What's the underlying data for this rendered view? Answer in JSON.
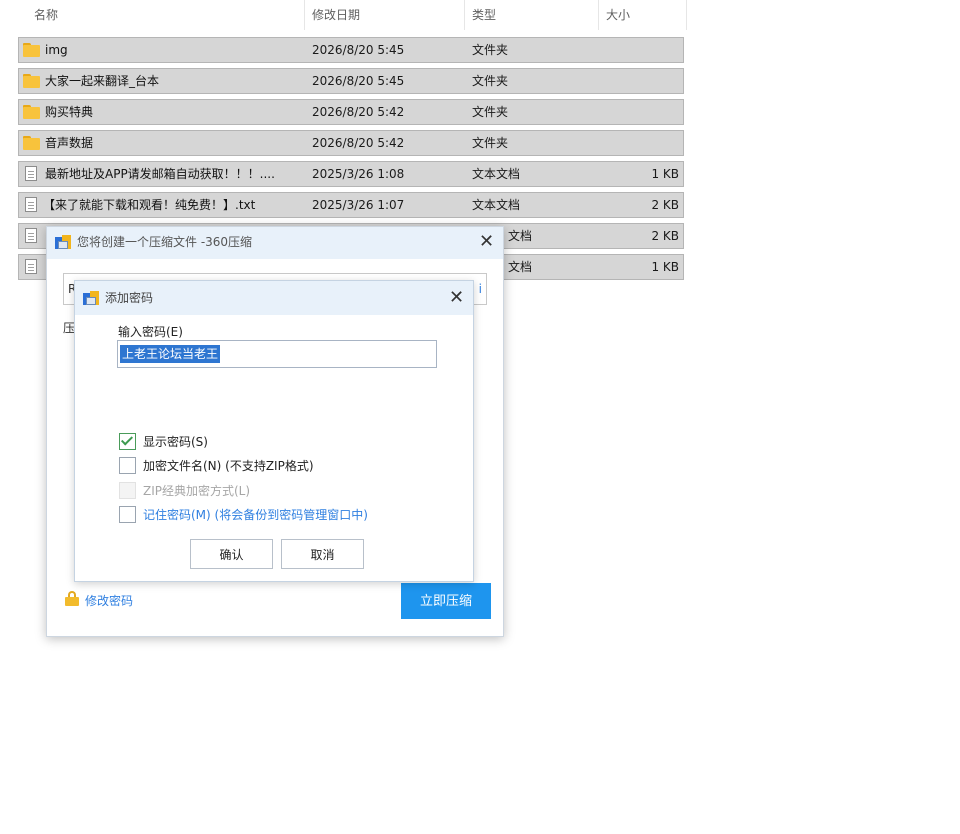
{
  "explorer": {
    "columns": {
      "name": "名称",
      "date": "修改日期",
      "type": "类型",
      "size": "大小"
    },
    "rows": [
      {
        "icon": "folder-icon",
        "name": "img",
        "date": "2026/8/20 5:45",
        "type": "文件夹",
        "size": ""
      },
      {
        "icon": "folder-icon",
        "name": "大家一起来翻译_台本",
        "date": "2026/8/20 5:45",
        "type": "文件夹",
        "size": ""
      },
      {
        "icon": "folder-icon",
        "name": "购买特典",
        "date": "2026/8/20 5:42",
        "type": "文件夹",
        "size": ""
      },
      {
        "icon": "folder-icon",
        "name": "音声数据",
        "date": "2026/8/20 5:42",
        "type": "文件夹",
        "size": ""
      },
      {
        "icon": "text-file-icon",
        "name": "最新地址及APP请发邮箱自动获取！！！....",
        "date": "2025/3/26 1:08",
        "type": "文本文档",
        "size": "1 KB"
      },
      {
        "icon": "text-file-icon",
        "name": "【来了就能下载和观看！纯免费！】.txt",
        "date": "2025/3/26 1:07",
        "type": "文本文档",
        "size": "2 KB"
      },
      {
        "icon": "text-file-icon",
        "name": "",
        "date": "",
        "type": "文档",
        "size": "2 KB"
      },
      {
        "icon": "text-file-icon",
        "name": "",
        "date": "",
        "type": "文档",
        "size": "1 KB"
      }
    ]
  },
  "compress_dialog": {
    "title": "您将创建一个压缩文件 -360压缩",
    "input_prefix": "R",
    "input_suffix": "i",
    "label_prefix": "压",
    "modify_password_link": "修改密码",
    "compress_now_button": "立即压缩"
  },
  "password_dialog": {
    "title": "添加密码",
    "password_label": "输入密码(E)",
    "password_value": "上老王论坛当老王",
    "options": [
      {
        "label": "显示密码(S)",
        "checked": true,
        "disabled": false,
        "style": "normal"
      },
      {
        "label": "加密文件名(N) (不支持ZIP格式)",
        "checked": false,
        "disabled": false,
        "style": "normal"
      },
      {
        "label": "ZIP经典加密方式(L)",
        "checked": false,
        "disabled": true,
        "style": "gray"
      },
      {
        "label": "记住密码(M) (将会备份到密码管理窗口中)",
        "checked": false,
        "disabled": false,
        "style": "blue"
      }
    ],
    "ok_button": "确认",
    "cancel_button": "取消"
  }
}
